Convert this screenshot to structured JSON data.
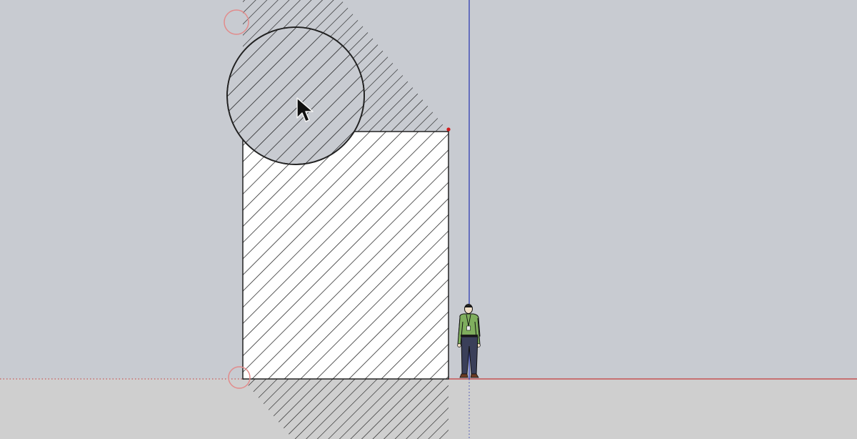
{
  "app": {
    "view": "3d-modeling-viewport"
  },
  "colors": {
    "sky": "#c8cbd1",
    "ground": "#cfcfcf",
    "red_axis": "#c43a3a",
    "green_axis": "#3a7a3a",
    "blue_axis": "#3b46b5",
    "hatch": "#111111",
    "inference_marker": "#e28b8b",
    "endpoint": "#d11a1a"
  },
  "icons": {
    "cursor": "arrow-cursor-icon",
    "scale_figure": "scale-figure-icon",
    "inference_point": "inference-circle-icon",
    "endpoint": "endpoint-icon"
  },
  "tool": {
    "active": "select"
  },
  "scene": {
    "objects": [
      "rectangle-face",
      "circle-face",
      "shadow",
      "scale-figure"
    ]
  }
}
